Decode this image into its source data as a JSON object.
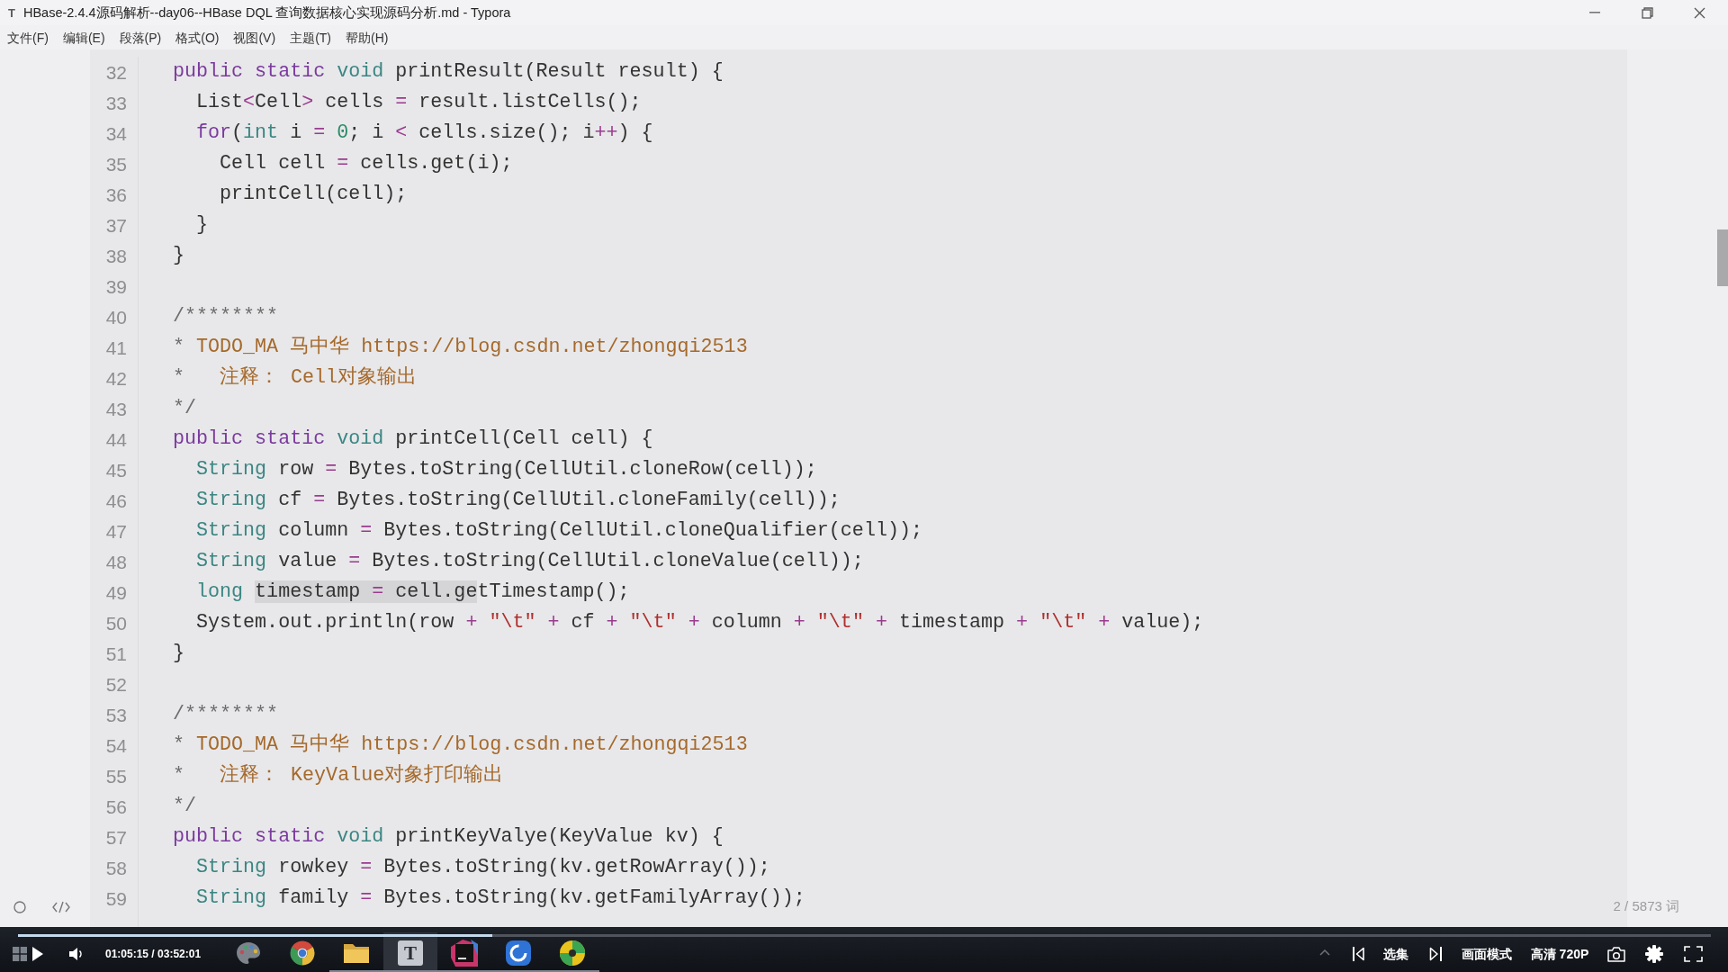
{
  "window": {
    "app_icon": "T",
    "title": "HBase-2.4.4源码解析--day06--HBase DQL 查询数据核心实现源码分析.md - Typora"
  },
  "menu": [
    {
      "label": "文件(F)"
    },
    {
      "label": "编辑(E)"
    },
    {
      "label": "段落(P)"
    },
    {
      "label": "格式(O)"
    },
    {
      "label": "视图(V)"
    },
    {
      "label": "主题(T)"
    },
    {
      "label": "帮助(H)"
    }
  ],
  "editor": {
    "lines": [
      {
        "number": "32",
        "tokens": [
          {
            "kind": "keyword",
            "text": "public"
          },
          {
            "kind": "keyword",
            "text": " static"
          },
          {
            "kind": "type",
            "text": " void"
          },
          {
            "kind": "plain",
            "text": " printResult(Result result) {"
          }
        ]
      },
      {
        "number": "33",
        "tokens": [
          {
            "kind": "plain",
            "text": "  List"
          },
          {
            "kind": "operator",
            "text": "<"
          },
          {
            "kind": "plain",
            "text": "Cell"
          },
          {
            "kind": "operator",
            "text": ">"
          },
          {
            "kind": "plain",
            "text": " cells "
          },
          {
            "kind": "operator",
            "text": "="
          },
          {
            "kind": "plain",
            "text": " result.listCells();"
          }
        ]
      },
      {
        "number": "34",
        "tokens": [
          {
            "kind": "keyword",
            "text": "  for"
          },
          {
            "kind": "plain",
            "text": "("
          },
          {
            "kind": "type",
            "text": "int"
          },
          {
            "kind": "plain",
            "text": " i "
          },
          {
            "kind": "operator",
            "text": "="
          },
          {
            "kind": "number",
            "text": " 0"
          },
          {
            "kind": "plain",
            "text": "; i "
          },
          {
            "kind": "operator",
            "text": "<"
          },
          {
            "kind": "plain",
            "text": " cells.size(); i"
          },
          {
            "kind": "operator",
            "text": "++"
          },
          {
            "kind": "plain",
            "text": ") {"
          }
        ]
      },
      {
        "number": "35",
        "tokens": [
          {
            "kind": "plain",
            "text": "    Cell cell "
          },
          {
            "kind": "operator",
            "text": "="
          },
          {
            "kind": "plain",
            "text": " cells.get(i);"
          }
        ]
      },
      {
        "number": "36",
        "tokens": [
          {
            "kind": "plain",
            "text": "    printCell(cell);"
          }
        ]
      },
      {
        "number": "37",
        "tokens": [
          {
            "kind": "plain",
            "text": "  }"
          }
        ]
      },
      {
        "number": "38",
        "tokens": [
          {
            "kind": "plain",
            "text": "}"
          }
        ]
      },
      {
        "number": "39"
      },
      {
        "number": "40",
        "tokens": [
          {
            "kind": "comment-mark",
            "text": "/********"
          }
        ]
      },
      {
        "number": "41",
        "tokens": [
          {
            "kind": "comment-mark",
            "text": "*"
          },
          {
            "kind": "comment",
            "text": " TODO_MA 马中华 https://blog.csdn.net/zhongqi2513"
          }
        ]
      },
      {
        "number": "42",
        "tokens": [
          {
            "kind": "comment-mark",
            "text": "*"
          },
          {
            "kind": "comment",
            "text": "   注释： Cell对象输出"
          }
        ]
      },
      {
        "number": "43",
        "tokens": [
          {
            "kind": "comment-mark",
            "text": "*/"
          }
        ]
      },
      {
        "number": "44",
        "tokens": [
          {
            "kind": "keyword",
            "text": "public"
          },
          {
            "kind": "keyword",
            "text": " static"
          },
          {
            "kind": "type",
            "text": " void"
          },
          {
            "kind": "plain",
            "text": " printCell(Cell cell) {"
          }
        ]
      },
      {
        "number": "45",
        "tokens": [
          {
            "kind": "type",
            "text": "  String"
          },
          {
            "kind": "plain",
            "text": " row "
          },
          {
            "kind": "operator",
            "text": "="
          },
          {
            "kind": "plain",
            "text": " Bytes.toString(CellUtil.cloneRow(cell));"
          }
        ]
      },
      {
        "number": "46",
        "tokens": [
          {
            "kind": "type",
            "text": "  String"
          },
          {
            "kind": "plain",
            "text": " cf "
          },
          {
            "kind": "operator",
            "text": "="
          },
          {
            "kind": "plain",
            "text": " Bytes.toString(CellUtil.cloneFamily(cell));"
          }
        ]
      },
      {
        "number": "47",
        "tokens": [
          {
            "kind": "type",
            "text": "  String"
          },
          {
            "kind": "plain",
            "text": " column "
          },
          {
            "kind": "operator",
            "text": "="
          },
          {
            "kind": "plain",
            "text": " Bytes.toString(CellUtil.cloneQualifier(cell));"
          }
        ]
      },
      {
        "number": "48",
        "tokens": [
          {
            "kind": "type",
            "text": "  String"
          },
          {
            "kind": "plain",
            "text": " value "
          },
          {
            "kind": "operator",
            "text": "="
          },
          {
            "kind": "plain",
            "text": " Bytes.toString(CellUtil.cloneValue(cell));"
          }
        ]
      },
      {
        "number": "49",
        "tokens": [
          {
            "kind": "type",
            "text": "  long "
          },
          {
            "kind": "selection",
            "tokens": [
              {
                "kind": "plain",
                "text": "timestamp "
              },
              {
                "kind": "operator",
                "text": "="
              },
              {
                "kind": "plain",
                "text": " cell.ge"
              }
            ]
          },
          {
            "kind": "plain",
            "text": "tTimestamp();"
          }
        ]
      },
      {
        "number": "50",
        "tokens": [
          {
            "kind": "plain",
            "text": "  System.out.println(row "
          },
          {
            "kind": "operator",
            "text": "+ "
          },
          {
            "kind": "string",
            "text": "\"\\t\""
          },
          {
            "kind": "operator",
            "text": " + "
          },
          {
            "kind": "plain",
            "text": "cf "
          },
          {
            "kind": "operator",
            "text": "+ "
          },
          {
            "kind": "string",
            "text": "\"\\t\""
          },
          {
            "kind": "operator",
            "text": " + "
          },
          {
            "kind": "plain",
            "text": "column "
          },
          {
            "kind": "operator",
            "text": "+ "
          },
          {
            "kind": "string",
            "text": "\"\\t\""
          },
          {
            "kind": "operator",
            "text": " + "
          },
          {
            "kind": "plain",
            "text": "timestamp "
          },
          {
            "kind": "operator",
            "text": "+ "
          },
          {
            "kind": "string",
            "text": "\"\\t\""
          },
          {
            "kind": "operator",
            "text": " + "
          },
          {
            "kind": "plain",
            "text": "value);"
          }
        ]
      },
      {
        "number": "51",
        "tokens": [
          {
            "kind": "plain",
            "text": "}"
          }
        ]
      },
      {
        "number": "52"
      },
      {
        "number": "53",
        "tokens": [
          {
            "kind": "comment-mark",
            "text": "/********"
          }
        ]
      },
      {
        "number": "54",
        "tokens": [
          {
            "kind": "comment-mark",
            "text": "*"
          },
          {
            "kind": "comment",
            "text": " TODO_MA 马中华 https://blog.csdn.net/zhongqi2513"
          }
        ]
      },
      {
        "number": "55",
        "tokens": [
          {
            "kind": "comment-mark",
            "text": "*"
          },
          {
            "kind": "comment",
            "text": "   注释： KeyValue对象打印输出"
          }
        ]
      },
      {
        "number": "56",
        "tokens": [
          {
            "kind": "comment-mark",
            "text": "*/"
          }
        ]
      },
      {
        "number": "57",
        "tokens": [
          {
            "kind": "keyword",
            "text": "public"
          },
          {
            "kind": "keyword",
            "text": " static"
          },
          {
            "kind": "type",
            "text": " void"
          },
          {
            "kind": "plain",
            "text": " printKeyValye(KeyValue kv) {"
          }
        ]
      },
      {
        "number": "58",
        "tokens": [
          {
            "kind": "type",
            "text": "  String"
          },
          {
            "kind": "plain",
            "text": " rowkey "
          },
          {
            "kind": "operator",
            "text": "="
          },
          {
            "kind": "plain",
            "text": " Bytes.toString(kv.getRowArray());"
          }
        ]
      },
      {
        "number": "59",
        "tokens": [
          {
            "kind": "type",
            "text": "  String"
          },
          {
            "kind": "plain",
            "text": " family "
          },
          {
            "kind": "operator",
            "text": "="
          },
          {
            "kind": "plain",
            "text": " Bytes.toString(kv.getFamilyArray());"
          }
        ]
      }
    ],
    "word_count": "2 / 5873 词"
  },
  "player": {
    "progress": {
      "level": 0.28
    },
    "time": "01:05:15 / 03:52:01",
    "episodes": "选集",
    "picture_mode": "画面模式",
    "quality": "高清 720P"
  },
  "taskbar": {
    "apps": [
      {
        "kind": "palette",
        "open": false,
        "selected": false
      },
      {
        "kind": "ring",
        "open": false,
        "selected": false
      },
      {
        "kind": "folder",
        "open": true,
        "selected": false
      },
      {
        "kind": "letter",
        "label": "T",
        "open": true,
        "selected": true
      },
      {
        "kind": "square",
        "open": true,
        "selected": false
      },
      {
        "kind": "swirl",
        "open": true,
        "selected": false
      },
      {
        "kind": "disc",
        "open": true,
        "selected": false
      }
    ]
  }
}
